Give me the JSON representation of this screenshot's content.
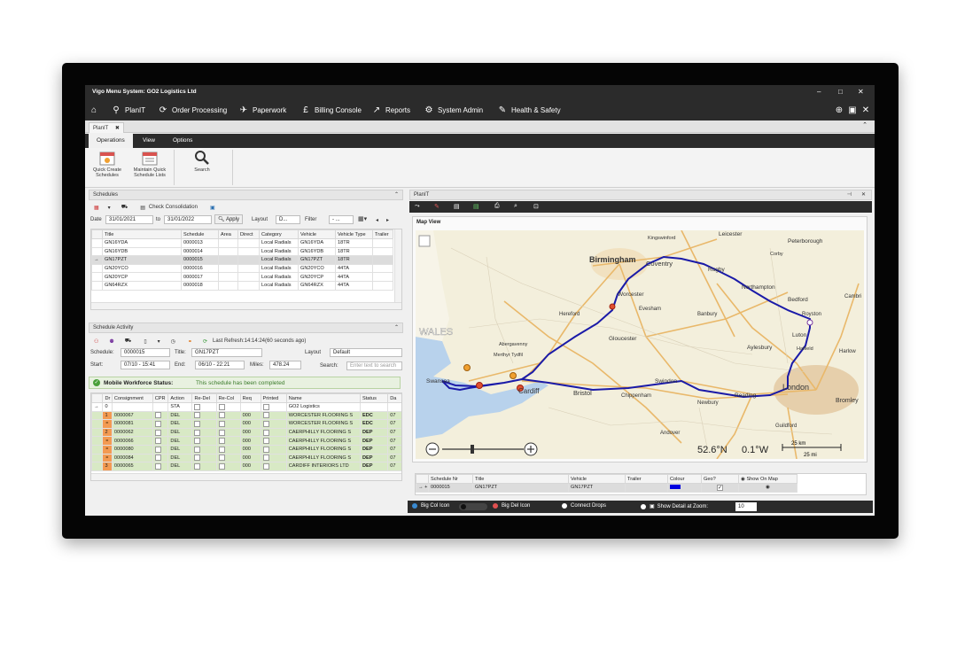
{
  "app": {
    "title": "Vigo Menu System: GO2 Logistics Ltd"
  },
  "menu": [
    {
      "icon": "home-icon",
      "label": ""
    },
    {
      "icon": "planit-icon",
      "label": "PlanIT"
    },
    {
      "icon": "order-processing-icon",
      "label": "Order Processing"
    },
    {
      "icon": "paperwork-icon",
      "label": "Paperwork"
    },
    {
      "icon": "billing-icon",
      "label": "Billing Console"
    },
    {
      "icon": "reports-icon",
      "label": "Reports"
    },
    {
      "icon": "system-admin-icon",
      "label": "System Admin"
    },
    {
      "icon": "health-safety-icon",
      "label": "Health & Safety"
    }
  ],
  "doc_tab": "PlanIT",
  "ribbon_tabs": [
    "Operations",
    "View",
    "Options"
  ],
  "ribbon_buttons": [
    {
      "label1": "Quick Create",
      "label2": "Schedules"
    },
    {
      "label1": "Maintain Quick",
      "label2": "Schedule Lists"
    },
    {
      "label1": "Search",
      "label2": ""
    }
  ],
  "schedules": {
    "header": "Schedules",
    "check_consolidation": "Check Consolidation",
    "date_label": "Date",
    "date_from": "31/01/2021",
    "to_label": "to",
    "date_to": "31/01/2022",
    "apply": "Apply",
    "layout_label": "Layout",
    "layout_value": "D...",
    "filter_label": "Filter",
    "filter_value": "- ...",
    "columns": [
      "Title",
      "Schedule",
      "Area",
      "Direct",
      "Category",
      "Vehicle",
      "Vehicle Type",
      "Trailer"
    ],
    "rows": [
      [
        "GN16YDA",
        "0000013",
        "",
        "",
        "Local Radials",
        "GN16YDA",
        "18TR",
        ""
      ],
      [
        "GN16YDB",
        "0000014",
        "",
        "",
        "Local Radials",
        "GN16YDB",
        "18TR",
        ""
      ],
      [
        "GN17PZT",
        "0000015",
        "",
        "",
        "Local Radials",
        "GN17PZT",
        "18TR",
        ""
      ],
      [
        "GN20YCO",
        "0000016",
        "",
        "",
        "Local Radials",
        "GN20YCO",
        "44TA",
        ""
      ],
      [
        "GN20YCP",
        "0000017",
        "",
        "",
        "Local Radials",
        "GN20YCP",
        "44TA",
        ""
      ],
      [
        "GN64RZX",
        "0000018",
        "",
        "",
        "Local Radials",
        "GN64RZX",
        "44TA",
        ""
      ]
    ]
  },
  "activity": {
    "header": "Schedule Activity",
    "last_refresh": "Last Refresh:14:14:24(60 seconds ago)",
    "schedule_label": "Schedule:",
    "schedule_value": "0000015",
    "title_label": "Title:",
    "title_value": "GN17PZT",
    "layout_label": "Layout",
    "layout_value": "Default",
    "start_label": "Start:",
    "start_value": "07/10 - 15:41",
    "end_label": "End:",
    "end_value": "06/10 - 22:21",
    "miles_label": "Miles:",
    "miles_value": "478.24",
    "search_label": "Search:",
    "search_placeholder": "Enter text to search",
    "mobile_label": "Mobile Workforce Status:",
    "mobile_status": "This schedule has been completed",
    "columns": [
      "Dr",
      "Consignment",
      "CPR",
      "Action",
      "Re-Del",
      "Re-Col",
      "Req",
      "Printed",
      "Name",
      "Status",
      "Da"
    ],
    "rows": [
      {
        "dr": "0",
        "cons": "",
        "action": "STA",
        "req": "",
        "name": "GO2 Logistics",
        "status": "",
        "da": "",
        "style": "plain"
      },
      {
        "dr": "1",
        "cons": "0000067",
        "action": "DEL",
        "req": "000",
        "name": "WORCESTER FLOORING S",
        "status": "EDC",
        "da": "07",
        "style": "green"
      },
      {
        "dr": "",
        "cons": "0000081",
        "action": "DEL",
        "req": "000",
        "name": "WORCESTER FLOORING S",
        "status": "EDC",
        "da": "07",
        "style": "green"
      },
      {
        "dr": "2",
        "cons": "0000062",
        "action": "DEL",
        "req": "000",
        "name": "CAERPHILLY FLOORING S",
        "status": "DEP",
        "da": "07",
        "style": "green"
      },
      {
        "dr": "",
        "cons": "0000066",
        "action": "DEL",
        "req": "000",
        "name": "CAERPHILLY FLOORING S",
        "status": "DEP",
        "da": "07",
        "style": "green"
      },
      {
        "dr": "",
        "cons": "0000080",
        "action": "DEL",
        "req": "000",
        "name": "CAERPHILLY FLOORING S",
        "status": "DEP",
        "da": "07",
        "style": "green"
      },
      {
        "dr": "",
        "cons": "0000084",
        "action": "DEL",
        "req": "000",
        "name": "CAERPHILLY FLOORING S",
        "status": "DEP",
        "da": "07",
        "style": "green"
      },
      {
        "dr": "3",
        "cons": "0000065",
        "action": "DEL",
        "req": "000",
        "name": "CARDIFF INTERIORS LTD",
        "status": "DEP",
        "da": "07",
        "style": "green"
      }
    ]
  },
  "planit": {
    "header": "PlanIT",
    "map_view": "Map View",
    "coords_lat": "52.6°N",
    "coords_lon": "0.1°W",
    "scale_km": "25 km",
    "scale_mi": "25 mi",
    "places": [
      "Birmingham",
      "Coventry",
      "Leicester",
      "Peterborough",
      "Rugby",
      "Northampton",
      "Bedford",
      "Worcester",
      "Evesham",
      "Banbury",
      "Royston",
      "Hereford",
      "Gloucester",
      "Aylesbury",
      "Luton",
      "Hatfield",
      "Harlow",
      "WALES",
      "Swansea",
      "Cardiff",
      "Bristol",
      "Chippenham",
      "Swindon",
      "Newbury",
      "Reading",
      "London",
      "Bromley",
      "Guildford",
      "Andover",
      "Kingswinford",
      "Corby",
      "Cambri",
      "Merthyr Tydfil",
      "Abergavenny"
    ],
    "columns": [
      "Schedule Nr",
      "Title",
      "Vehicle",
      "Trailer",
      "Colour",
      "Geo?",
      "Show On Map"
    ],
    "row": {
      "schedule": "0000015",
      "title": "GN17PZT",
      "vehicle": "GN17PZT",
      "trailer": "",
      "colour": "#0000e0"
    },
    "route_color": "#1a1aa8"
  },
  "bottom": {
    "big_col": "Big Col Icon",
    "big_del": "Big Del Icon",
    "connect_drops": "Connect Drops",
    "show_detail": "Show Detail at Zoom:",
    "zoom_value": "10"
  }
}
